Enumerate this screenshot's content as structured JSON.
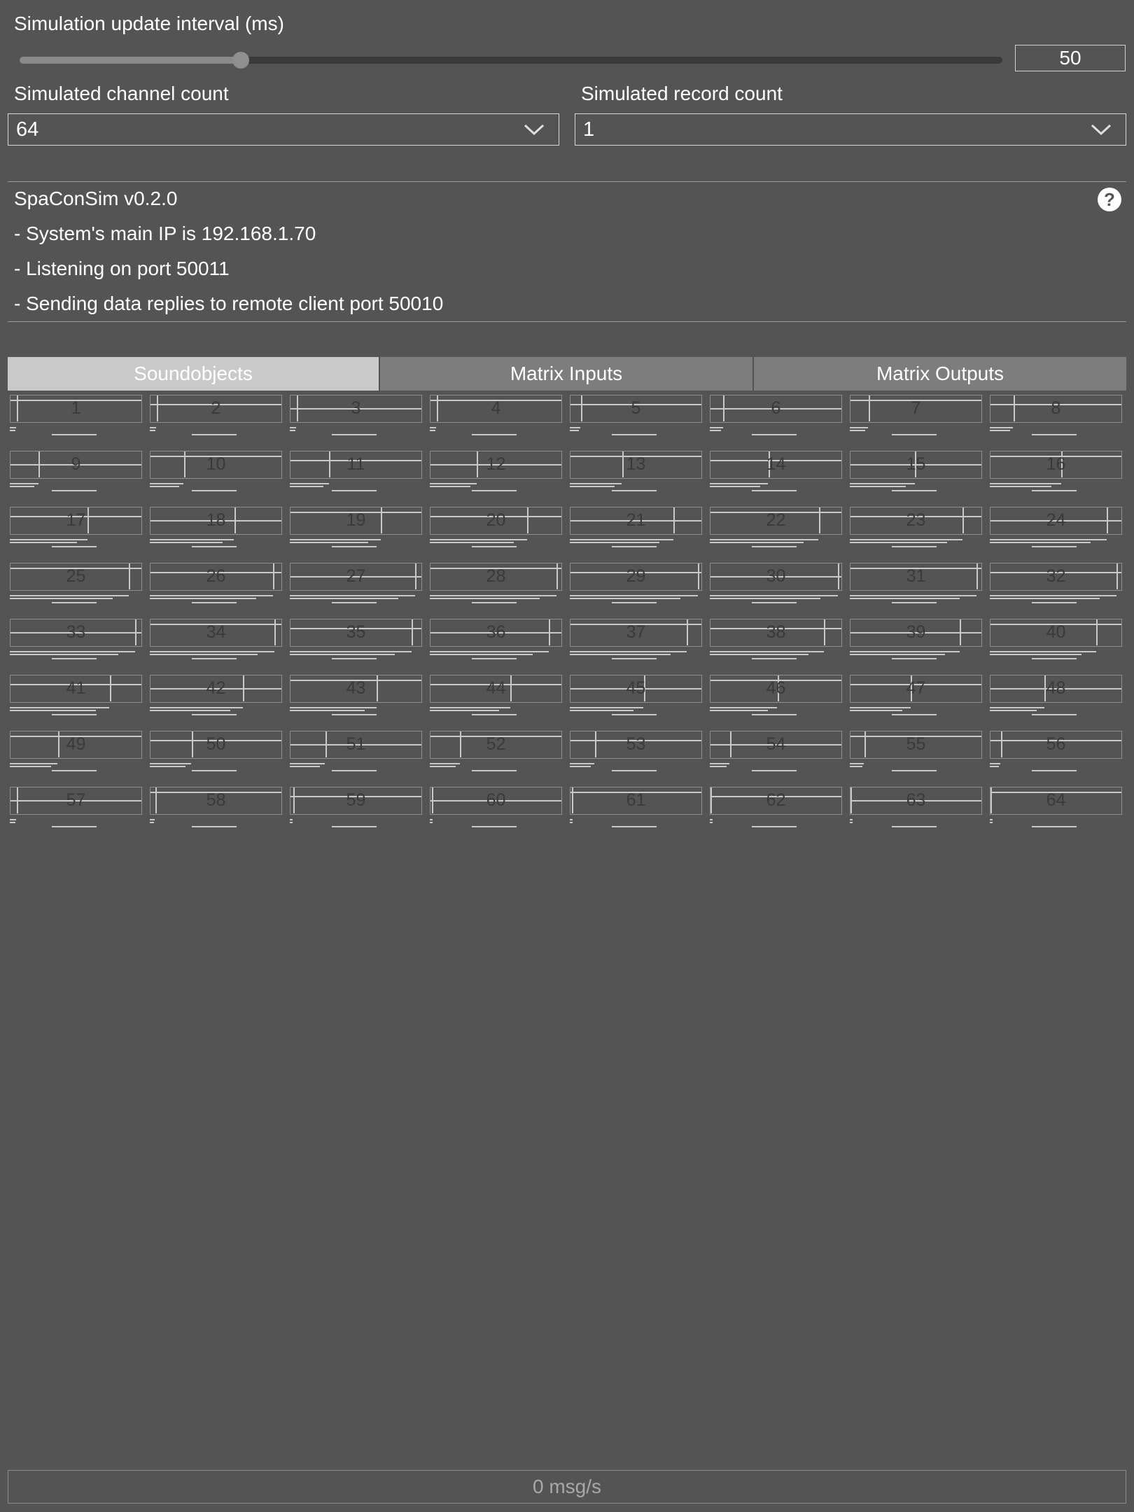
{
  "interval": {
    "label": "Simulation update interval (ms)",
    "value": "50",
    "slider_fraction": 0.225
  },
  "channel": {
    "label": "Simulated channel count",
    "value": "64"
  },
  "record": {
    "label": "Simulated record count",
    "value": "1"
  },
  "info": {
    "title": "SpaConSim v0.2.0",
    "lines": [
      "- System's main IP is 192.168.1.70",
      "- Listening on port 50011",
      "- Sending data replies to remote client port 50010"
    ],
    "help_glyph": "?"
  },
  "tabs": [
    "Soundobjects",
    "Matrix Inputs",
    "Matrix Outputs"
  ],
  "active_tab": "Soundobjects",
  "channels": [
    "1",
    "2",
    "3",
    "4",
    "5",
    "6",
    "7",
    "8",
    "9",
    "10",
    "11",
    "12",
    "13",
    "14",
    "15",
    "16",
    "17",
    "18",
    "19",
    "20",
    "21",
    "22",
    "23",
    "24",
    "25",
    "26",
    "27",
    "28",
    "29",
    "30",
    "31",
    "32",
    "33",
    "34",
    "35",
    "36",
    "37",
    "38",
    "39",
    "40",
    "41",
    "42",
    "43",
    "44",
    "45",
    "46",
    "47",
    "48",
    "49",
    "50",
    "51",
    "52",
    "53",
    "54",
    "55",
    "56",
    "57",
    "58",
    "59",
    "60",
    "61",
    "62",
    "63",
    "64"
  ],
  "channel_x_levels": [
    0.05,
    0.05,
    0.05,
    0.05,
    0.08,
    0.1,
    0.14,
    0.18,
    0.22,
    0.26,
    0.3,
    0.36,
    0.4,
    0.45,
    0.5,
    0.55,
    0.6,
    0.65,
    0.7,
    0.75,
    0.8,
    0.84,
    0.87,
    0.9,
    0.92,
    0.95,
    0.97,
    0.98,
    0.99,
    0.99,
    0.98,
    0.98,
    0.97,
    0.96,
    0.94,
    0.92,
    0.9,
    0.88,
    0.85,
    0.82,
    0.77,
    0.72,
    0.67,
    0.62,
    0.57,
    0.52,
    0.47,
    0.42,
    0.37,
    0.32,
    0.27,
    0.23,
    0.19,
    0.15,
    0.11,
    0.08,
    0.05,
    0.04,
    0.02,
    0.01,
    0.01,
    0.0,
    0.0,
    0.0
  ],
  "status": {
    "rate": "0 msg/s"
  }
}
